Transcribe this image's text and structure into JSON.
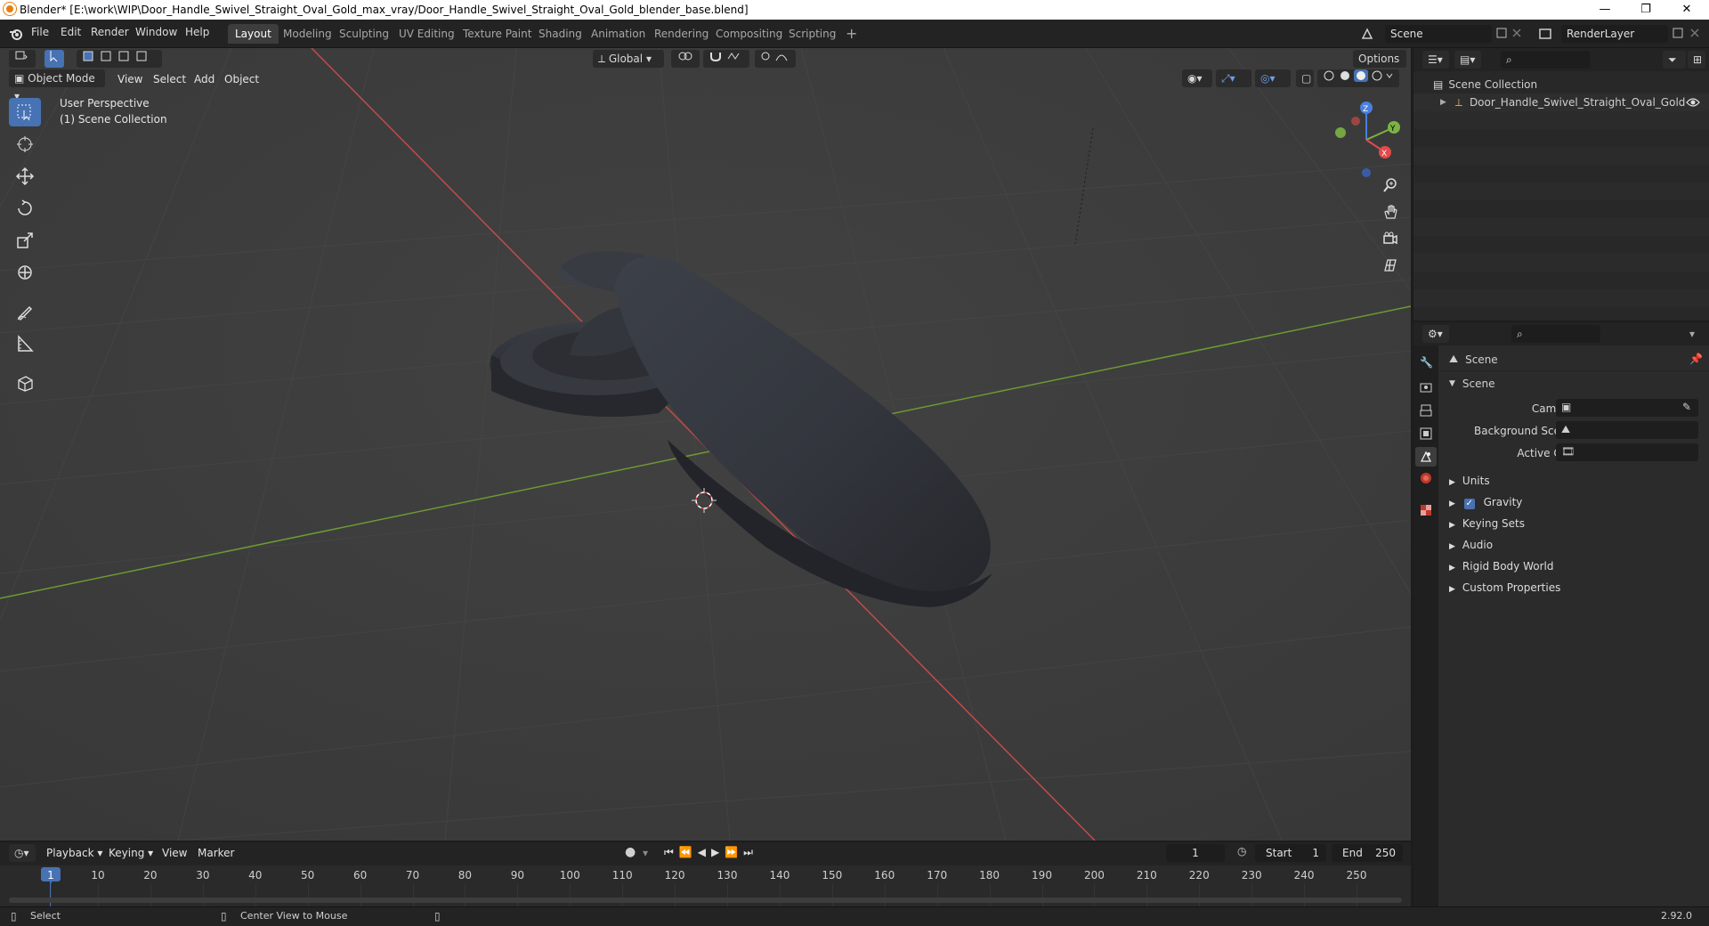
{
  "window": {
    "title": "Blender* [E:\\work\\WIP\\Door_Handle_Swivel_Straight_Oval_Gold_max_vray/Door_Handle_Swivel_Straight_Oval_Gold_blender_base.blend]",
    "minimize": "—",
    "maximize": "❐",
    "close": "✕"
  },
  "menubar": {
    "items": [
      "File",
      "Edit",
      "Render",
      "Window",
      "Help"
    ]
  },
  "workspaces": {
    "tabs": [
      "Layout",
      "Modeling",
      "Sculpting",
      "UV Editing",
      "Texture Paint",
      "Shading",
      "Animation",
      "Rendering",
      "Compositing",
      "Scripting"
    ],
    "active": "Layout",
    "add": "+"
  },
  "scene_selector": {
    "value": "Scene"
  },
  "renderlayer_selector": {
    "value": "RenderLayer"
  },
  "viewport": {
    "mode": "Object Mode",
    "menus": [
      "View",
      "Select",
      "Add",
      "Object"
    ],
    "orientation": "Global",
    "options": "Options",
    "perspective_label": "User Perspective",
    "collection_label": "(1) Scene Collection",
    "gizmo": {
      "x": "X",
      "y": "Y",
      "z": "Z"
    }
  },
  "outliner": {
    "root": "Scene Collection",
    "items": [
      {
        "label": "Door_Handle_Swivel_Straight_Oval_Gold"
      }
    ]
  },
  "properties": {
    "context": "Scene",
    "section": "Scene",
    "fields": [
      {
        "label": "Camera",
        "value": ""
      },
      {
        "label": "Background Scene",
        "value": ""
      },
      {
        "label": "Active Clip",
        "value": ""
      }
    ],
    "panels": [
      "Units",
      "Gravity",
      "Keying Sets",
      "Audio",
      "Rigid Body World",
      "Custom Properties"
    ],
    "gravity_checked": true
  },
  "timeline": {
    "menus": [
      "Playback",
      "Keying",
      "View",
      "Marker"
    ],
    "current_frame": "1",
    "start_label": "Start",
    "start": "1",
    "end_label": "End",
    "end": "250",
    "ticks": [
      "1",
      "10",
      "20",
      "30",
      "40",
      "50",
      "60",
      "70",
      "80",
      "90",
      "100",
      "110",
      "120",
      "130",
      "140",
      "150",
      "160",
      "170",
      "180",
      "190",
      "200",
      "210",
      "220",
      "230",
      "240",
      "250"
    ]
  },
  "statusbar": {
    "select": "Select",
    "center_view": "Center View to Mouse",
    "version": "2.92.0"
  },
  "colors": {
    "accent": "#4772b3",
    "x_axis": "#e04b4b",
    "y_axis": "#7cb342",
    "z_axis": "#4a7fe0"
  }
}
